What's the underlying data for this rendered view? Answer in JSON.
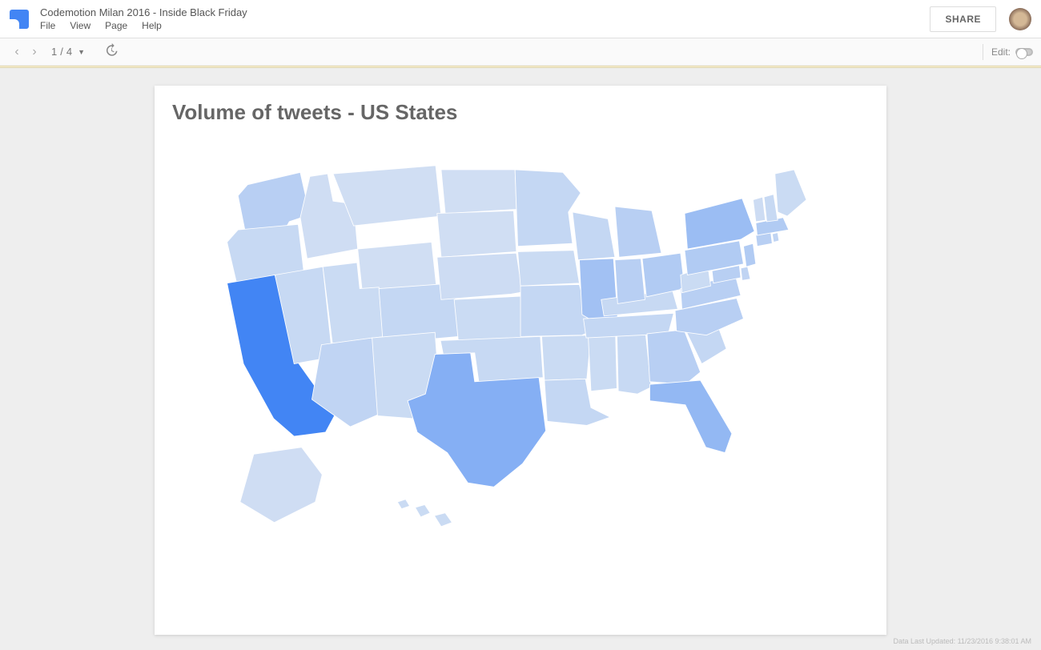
{
  "header": {
    "doc_title": "Codemotion Milan 2016 - Inside Black Friday",
    "menu": {
      "file": "File",
      "view": "View",
      "page": "Page",
      "help": "Help"
    },
    "share": "SHARE"
  },
  "toolbar": {
    "page_current": "1",
    "page_sep": "/",
    "page_total": "4",
    "edit_label": "Edit:"
  },
  "report": {
    "title": "Volume of tweets - US States"
  },
  "footer": {
    "updated": "Data Last Updated: 11/23/2016 9:38:01 AM"
  },
  "chart_data": {
    "type": "choropleth-map",
    "title": "Volume of tweets - US States",
    "region": "US States",
    "metric": "Volume of tweets",
    "color_scale": {
      "low": "#d6e2f3",
      "high": "#4285f4"
    },
    "states": [
      {
        "code": "CA",
        "name": "California",
        "intensity": 1.0
      },
      {
        "code": "TX",
        "name": "Texas",
        "intensity": 0.55
      },
      {
        "code": "FL",
        "name": "Florida",
        "intensity": 0.45
      },
      {
        "code": "NY",
        "name": "New York",
        "intensity": 0.4
      },
      {
        "code": "IL",
        "name": "Illinois",
        "intensity": 0.35
      },
      {
        "code": "OH",
        "name": "Ohio",
        "intensity": 0.25
      },
      {
        "code": "PA",
        "name": "Pennsylvania",
        "intensity": 0.25
      },
      {
        "code": "GA",
        "name": "Georgia",
        "intensity": 0.2
      },
      {
        "code": "WA",
        "name": "Washington",
        "intensity": 0.2
      },
      {
        "code": "NJ",
        "name": "New Jersey",
        "intensity": 0.25
      },
      {
        "code": "MA",
        "name": "Massachusetts",
        "intensity": 0.25
      },
      {
        "code": "NC",
        "name": "North Carolina",
        "intensity": 0.2
      },
      {
        "code": "VA",
        "name": "Virginia",
        "intensity": 0.2
      },
      {
        "code": "MI",
        "name": "Michigan",
        "intensity": 0.2
      },
      {
        "code": "IN",
        "name": "Indiana",
        "intensity": 0.2
      },
      {
        "code": "MD",
        "name": "Maryland",
        "intensity": 0.2
      },
      {
        "code": "AZ",
        "name": "Arizona",
        "intensity": 0.15
      },
      {
        "code": "CO",
        "name": "Colorado",
        "intensity": 0.12
      },
      {
        "code": "TN",
        "name": "Tennessee",
        "intensity": 0.12
      },
      {
        "code": "MO",
        "name": "Missouri",
        "intensity": 0.12
      },
      {
        "code": "WI",
        "name": "Wisconsin",
        "intensity": 0.12
      },
      {
        "code": "MN",
        "name": "Minnesota",
        "intensity": 0.12
      },
      {
        "code": "CT",
        "name": "Connecticut",
        "intensity": 0.2
      },
      {
        "code": "OR",
        "name": "Oregon",
        "intensity": 0.1
      },
      {
        "code": "SC",
        "name": "South Carolina",
        "intensity": 0.12
      },
      {
        "code": "AL",
        "name": "Alabama",
        "intensity": 0.1
      },
      {
        "code": "LA",
        "name": "Louisiana",
        "intensity": 0.12
      },
      {
        "code": "KY",
        "name": "Kentucky",
        "intensity": 0.1
      },
      {
        "code": "OK",
        "name": "Oklahoma",
        "intensity": 0.1
      },
      {
        "code": "NV",
        "name": "Nevada",
        "intensity": 0.1
      },
      {
        "code": "UT",
        "name": "Utah",
        "intensity": 0.08
      },
      {
        "code": "KS",
        "name": "Kansas",
        "intensity": 0.08
      },
      {
        "code": "AR",
        "name": "Arkansas",
        "intensity": 0.08
      },
      {
        "code": "IA",
        "name": "Iowa",
        "intensity": 0.08
      },
      {
        "code": "MS",
        "name": "Mississippi",
        "intensity": 0.08
      },
      {
        "code": "NM",
        "name": "New Mexico",
        "intensity": 0.08
      },
      {
        "code": "NE",
        "name": "Nebraska",
        "intensity": 0.06
      },
      {
        "code": "WV",
        "name": "West Virginia",
        "intensity": 0.08
      },
      {
        "code": "ID",
        "name": "Idaho",
        "intensity": 0.05
      },
      {
        "code": "NH",
        "name": "New Hampshire",
        "intensity": 0.1
      },
      {
        "code": "ME",
        "name": "Maine",
        "intensity": 0.08
      },
      {
        "code": "RI",
        "name": "Rhode Island",
        "intensity": 0.15
      },
      {
        "code": "DE",
        "name": "Delaware",
        "intensity": 0.15
      },
      {
        "code": "MT",
        "name": "Montana",
        "intensity": 0.04
      },
      {
        "code": "SD",
        "name": "South Dakota",
        "intensity": 0.04
      },
      {
        "code": "ND",
        "name": "North Dakota",
        "intensity": 0.04
      },
      {
        "code": "WY",
        "name": "Wyoming",
        "intensity": 0.04
      },
      {
        "code": "VT",
        "name": "Vermont",
        "intensity": 0.06
      },
      {
        "code": "AK",
        "name": "Alaska",
        "intensity": 0.05
      },
      {
        "code": "HI",
        "name": "Hawaii",
        "intensity": 0.08
      }
    ]
  }
}
